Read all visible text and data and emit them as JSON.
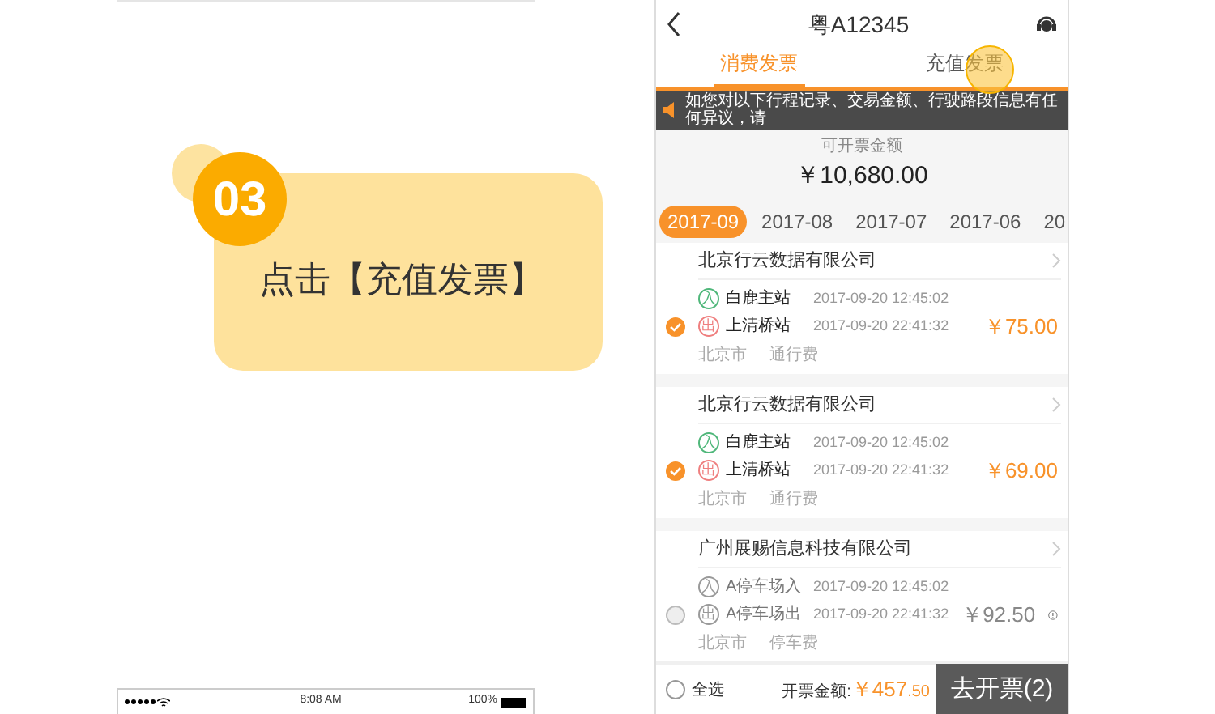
{
  "guide": {
    "step": "03",
    "instruction": "点击【充值发票】"
  },
  "left_phone": {
    "status_bar": {
      "time": "8:08 AM",
      "battery": "100%"
    }
  },
  "phone": {
    "title": "粤A12345",
    "tabs": [
      {
        "label": "消费发票",
        "selected": true,
        "tapped": false
      },
      {
        "label": "充值发票",
        "selected": false,
        "tapped": true
      }
    ],
    "notice": "如您对以下行程记录、交易金额、行驶路段信息有任何异议，请",
    "balance": {
      "label": "可开票金额",
      "amount": "￥10,680.00"
    },
    "months": [
      {
        "label": "2017-09",
        "selected": true
      },
      {
        "label": "2017-08",
        "selected": false
      },
      {
        "label": "2017-07",
        "selected": false
      },
      {
        "label": "2017-06",
        "selected": false
      },
      {
        "label": "20",
        "selected": false
      }
    ],
    "records": [
      {
        "company": "北京行云数据有限公司",
        "checked": true,
        "enabled": true,
        "entry": {
          "badge": "入",
          "station": "白鹿主站",
          "time": "2017-09-20 12:45:02"
        },
        "exit": {
          "badge": "出",
          "station": "上清桥站",
          "time": "2017-09-20 22:41:32"
        },
        "city": "北京市",
        "category": "通行费",
        "amount": "￥75.00",
        "warning": false
      },
      {
        "company": "北京行云数据有限公司",
        "checked": true,
        "enabled": true,
        "entry": {
          "badge": "入",
          "station": "白鹿主站",
          "time": "2017-09-20 12:45:02"
        },
        "exit": {
          "badge": "出",
          "station": "上清桥站",
          "time": "2017-09-20 22:41:32"
        },
        "city": "北京市",
        "category": "通行费",
        "amount": "￥69.00",
        "warning": false
      },
      {
        "company": "广州展赐信息科技有限公司",
        "checked": false,
        "enabled": false,
        "entry": {
          "badge": "入",
          "station": "A停车场入",
          "time": "2017-09-20 12:45:02"
        },
        "exit": {
          "badge": "出",
          "station": "A停车场出",
          "time": "2017-09-20 22:41:32"
        },
        "city": "北京市",
        "category": "停车费",
        "amount": "￥92.50",
        "warning": true
      }
    ],
    "footer": {
      "select_all": {
        "label": "全选",
        "checked": false
      },
      "total_label": "开票金额:",
      "total_main": "￥457",
      "total_decimal": ".50",
      "button": "去开票(2)"
    }
  }
}
